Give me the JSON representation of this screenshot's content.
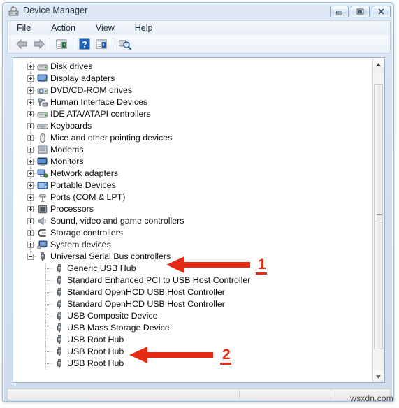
{
  "window": {
    "title": "Device Manager",
    "icon": "device-manager-icon",
    "buttons": {
      "minimize": "minimize-icon",
      "maximize": "maximize-icon",
      "close": "close-icon"
    }
  },
  "menubar": {
    "items": [
      {
        "label": "File",
        "name": "menu-file"
      },
      {
        "label": "Action",
        "name": "menu-action"
      },
      {
        "label": "View",
        "name": "menu-view"
      },
      {
        "label": "Help",
        "name": "menu-help"
      }
    ]
  },
  "toolbar": {
    "items": [
      {
        "name": "back-icon",
        "glyph": "back-arrow"
      },
      {
        "name": "forward-icon",
        "glyph": "forward-arrow"
      },
      {
        "name": "toolbar-separator-1",
        "glyph": "separator"
      },
      {
        "name": "show-hide-console-tree-icon",
        "glyph": "list-panel"
      },
      {
        "name": "toolbar-separator-2",
        "glyph": "separator"
      },
      {
        "name": "help-icon",
        "glyph": "question-mark"
      },
      {
        "name": "properties-icon",
        "glyph": "list-panel-right"
      },
      {
        "name": "toolbar-separator-3",
        "glyph": "separator"
      },
      {
        "name": "scan-for-hardware-changes-icon",
        "glyph": "scan-magnifier"
      }
    ]
  },
  "tree": {
    "nodes": [
      {
        "label": "Disk drives",
        "icon": "disk-drive-icon",
        "state": "collapsed",
        "level": 1
      },
      {
        "label": "Display adapters",
        "icon": "display-adapter-icon",
        "state": "collapsed",
        "level": 1
      },
      {
        "label": "DVD/CD-ROM drives",
        "icon": "dvd-drive-icon",
        "state": "collapsed",
        "level": 1
      },
      {
        "label": "Human Interface Devices",
        "icon": "hid-icon",
        "state": "collapsed",
        "level": 1
      },
      {
        "label": "IDE ATA/ATAPI controllers",
        "icon": "ide-controller-icon",
        "state": "collapsed",
        "level": 1
      },
      {
        "label": "Keyboards",
        "icon": "keyboard-icon",
        "state": "collapsed",
        "level": 1
      },
      {
        "label": "Mice and other pointing devices",
        "icon": "mouse-icon",
        "state": "collapsed",
        "level": 1
      },
      {
        "label": "Modems",
        "icon": "modem-icon",
        "state": "collapsed",
        "level": 1
      },
      {
        "label": "Monitors",
        "icon": "monitor-icon",
        "state": "collapsed",
        "level": 1
      },
      {
        "label": "Network adapters",
        "icon": "network-adapter-icon",
        "state": "collapsed",
        "level": 1
      },
      {
        "label": "Portable Devices",
        "icon": "portable-device-icon",
        "state": "collapsed",
        "level": 1
      },
      {
        "label": "Ports (COM & LPT)",
        "icon": "port-icon",
        "state": "collapsed",
        "level": 1
      },
      {
        "label": "Processors",
        "icon": "processor-icon",
        "state": "collapsed",
        "level": 1
      },
      {
        "label": "Sound, video and game controllers",
        "icon": "sound-controller-icon",
        "state": "collapsed",
        "level": 1
      },
      {
        "label": "Storage controllers",
        "icon": "storage-controller-icon",
        "state": "collapsed",
        "level": 1
      },
      {
        "label": "System devices",
        "icon": "system-device-icon",
        "state": "collapsed",
        "level": 1
      },
      {
        "label": "Universal Serial Bus controllers",
        "icon": "usb-icon",
        "state": "expanded",
        "level": 1
      },
      {
        "label": "Generic USB Hub",
        "icon": "usb-device-icon",
        "state": "leaf",
        "level": 2
      },
      {
        "label": "Standard Enhanced PCI to USB Host Controller",
        "icon": "usb-device-icon",
        "state": "leaf",
        "level": 2
      },
      {
        "label": "Standard OpenHCD USB Host Controller",
        "icon": "usb-device-icon",
        "state": "leaf",
        "level": 2
      },
      {
        "label": "Standard OpenHCD USB Host Controller",
        "icon": "usb-device-icon",
        "state": "leaf",
        "level": 2
      },
      {
        "label": "USB Composite Device",
        "icon": "usb-device-icon",
        "state": "leaf",
        "level": 2
      },
      {
        "label": "USB Mass Storage Device",
        "icon": "usb-device-icon",
        "state": "leaf",
        "level": 2
      },
      {
        "label": "USB Root Hub",
        "icon": "usb-device-icon",
        "state": "leaf",
        "level": 2
      },
      {
        "label": "USB Root Hub",
        "icon": "usb-device-icon",
        "state": "leaf",
        "level": 2
      },
      {
        "label": "USB Root Hub",
        "icon": "usb-device-icon",
        "state": "leaf",
        "level": 2
      }
    ]
  },
  "scrollbar": {
    "up_arrow": "scroll-up-icon",
    "down_arrow": "scroll-down-icon",
    "thumb": "scroll-thumb"
  },
  "annotations": {
    "accent_color": "#e32b16",
    "markers": [
      {
        "number": "1",
        "points_to": "Universal Serial Bus controllers"
      },
      {
        "number": "2",
        "points_to": "USB Root Hub"
      }
    ]
  },
  "statusbar": {
    "text": ""
  },
  "watermark": {
    "text": "wsxdn.com"
  }
}
